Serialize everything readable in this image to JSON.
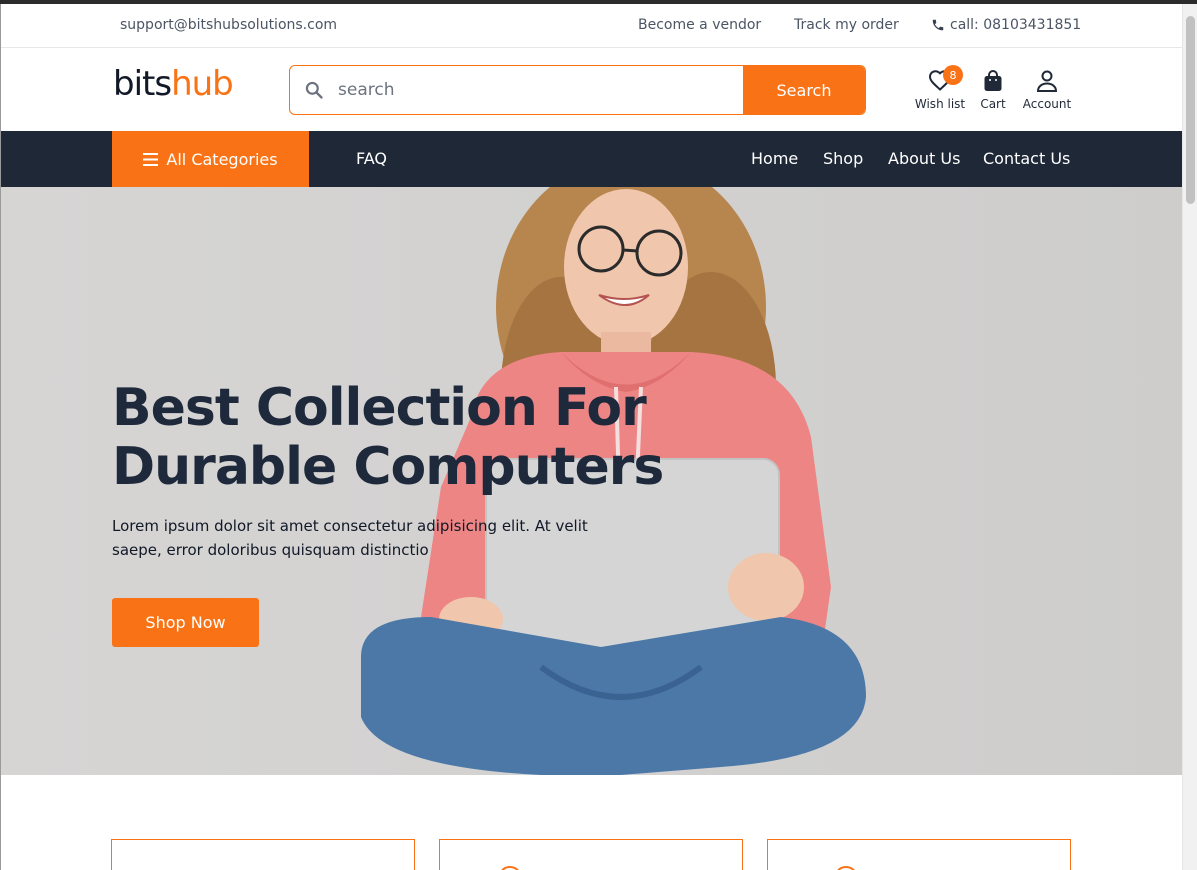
{
  "topbar": {
    "email": "support@bitshubsolutions.com",
    "become_vendor": "Become a vendor",
    "track_order": "Track my order",
    "call": "call: 08103431851"
  },
  "header": {
    "logo_part1": "bits",
    "logo_part2": "hub",
    "search_placeholder": "search",
    "search_button": "Search",
    "wishlist_label": "Wish list",
    "wishlist_count": "8",
    "cart_label": "Cart",
    "account_label": "Account"
  },
  "nav": {
    "all_categories": "All Categories",
    "faq": "FAQ",
    "links": [
      "Home",
      "Shop",
      "About Us",
      "Contact Us"
    ]
  },
  "hero": {
    "title_line1": "Best Collection For",
    "title_line2": "Durable Computers",
    "description": "Lorem ipsum dolor sit amet consectetur adipisicing elit. At velit saepe, error doloribus quisquam distinctio",
    "button": "Shop Now"
  },
  "colors": {
    "accent": "#f97316",
    "nav_bg": "#1e2837",
    "heading": "#1e293b"
  }
}
